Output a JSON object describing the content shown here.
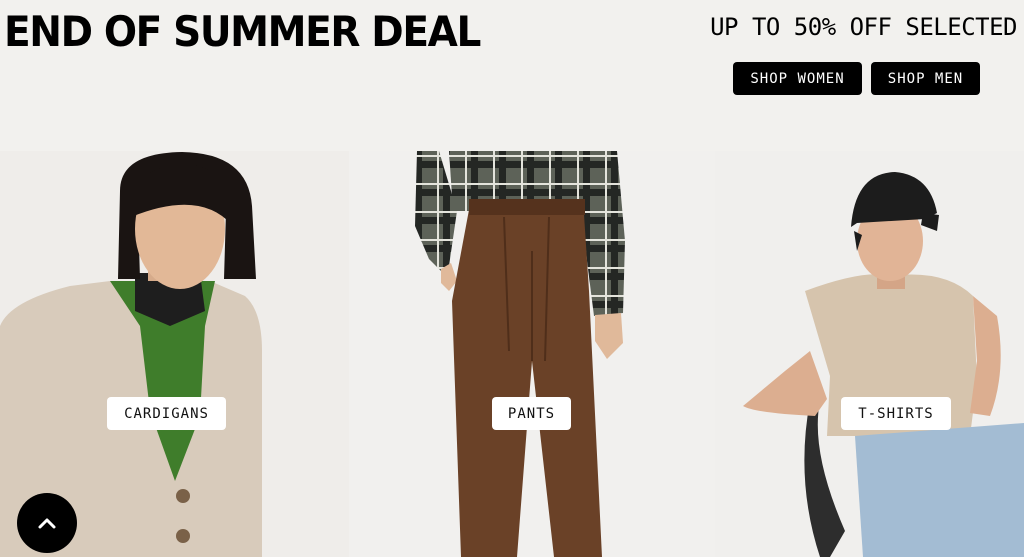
{
  "banner": {
    "headline": "END OF SUMMER DEAL",
    "subheadline": "UP TO 50% OFF SELECTED",
    "buttons": {
      "shop_women": "SHOP WOMEN",
      "shop_men": "SHOP MEN"
    }
  },
  "categories": [
    {
      "label": "CARDIGANS"
    },
    {
      "label": "PANTS"
    },
    {
      "label": "T-SHIRTS"
    }
  ],
  "colors": {
    "banner_background": "#f2f1ee",
    "button_background": "#000000",
    "button_text": "#ffffff",
    "label_background": "#ffffff"
  },
  "scroll_top_button": {
    "icon": "chevron-up-icon"
  }
}
